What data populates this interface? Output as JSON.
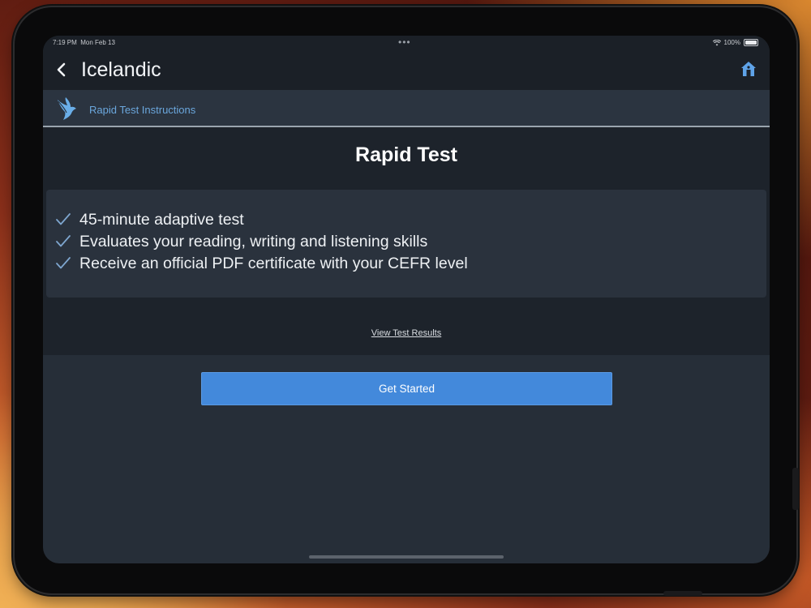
{
  "status_bar": {
    "time": "7:19 PM",
    "date": "Mon Feb 13",
    "multitask_indicator": "•••",
    "wifi_icon": "wifi-icon",
    "battery": "100%"
  },
  "nav": {
    "back_icon": "chevron-left-icon",
    "title": "Icelandic",
    "home_icon": "home-icon"
  },
  "subheader": {
    "logo_icon": "bird-logo-icon",
    "label": "Rapid Test Instructions"
  },
  "test": {
    "title": "Rapid Test",
    "features": [
      "45-minute adaptive test",
      "Evaluates your reading, writing and listening skills",
      "Receive an official PDF certificate with your CEFR level"
    ],
    "view_results_label": "View Test Results",
    "start_label": "Get Started"
  },
  "colors": {
    "accent": "#4389db",
    "link_blue": "#6ba7dd",
    "check": "#7ea6cf",
    "background": "#262e38",
    "navbar": "#1b2027",
    "card": "#1d232b"
  }
}
